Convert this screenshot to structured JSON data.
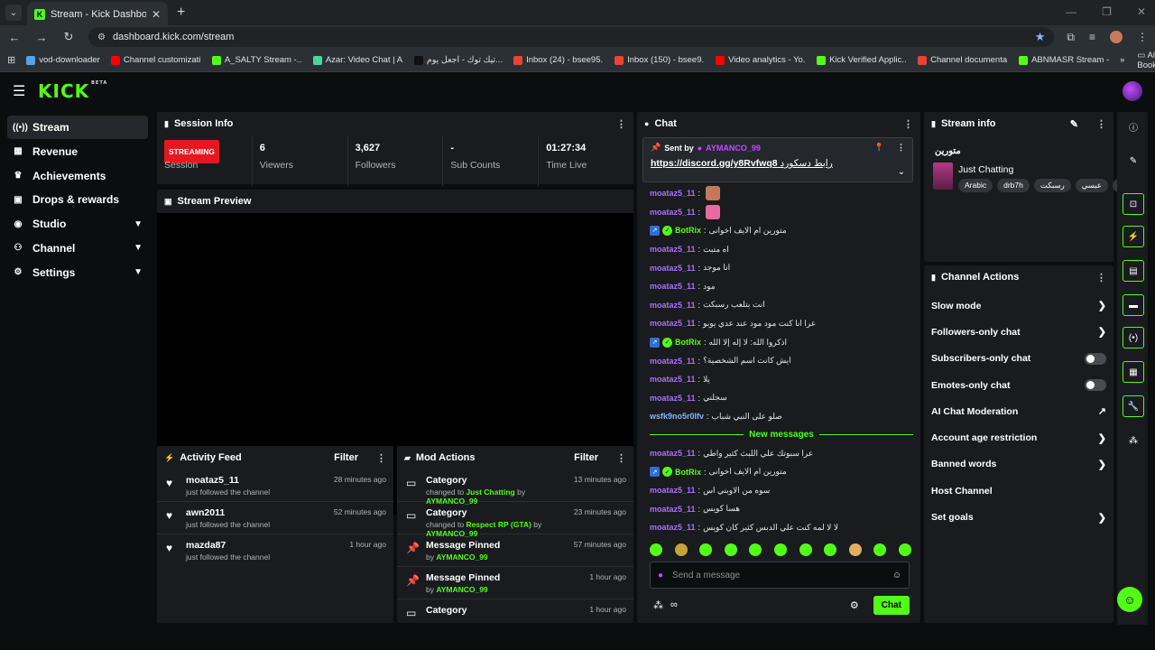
{
  "browser": {
    "tab_title": "Stream - Kick Dashboard",
    "url": "dashboard.kick.com/stream",
    "bookmarks": [
      {
        "label": "vod-downloader",
        "color": "#53a4e8"
      },
      {
        "label": "Channel customizati...",
        "color": "#ff0000"
      },
      {
        "label": "A_SALTY Stream -...",
        "color": "#53fc18"
      },
      {
        "label": "Azar: Video Chat | A...",
        "color": "#4ad6a0"
      },
      {
        "label": "تيك توك - اجعل يوم...",
        "color": "#111111"
      },
      {
        "label": "Inbox (24) - bsee95...",
        "color": "#ea4335"
      },
      {
        "label": "Inbox (150) - bsee9...",
        "color": "#ea4335"
      },
      {
        "label": "Video analytics - Yo...",
        "color": "#ff0000"
      },
      {
        "label": "Kick Verified Applic...",
        "color": "#53fc18"
      },
      {
        "label": "Channel documenta...",
        "color": "#ea4335"
      },
      {
        "label": "ABNMASR Stream -...",
        "color": "#53fc18"
      }
    ],
    "all_bookmarks": "All Bookmarks"
  },
  "app": {
    "logo": "KICK",
    "logo_badge": "BETA"
  },
  "sidebar": {
    "items": [
      {
        "label": "Stream",
        "icon": "broadcast-icon"
      },
      {
        "label": "Revenue",
        "icon": "revenue-icon"
      },
      {
        "label": "Achievements",
        "icon": "trophy-icon"
      },
      {
        "label": "Drops & rewards",
        "icon": "gift-icon"
      },
      {
        "label": "Studio",
        "icon": "studio-icon"
      },
      {
        "label": "Channel",
        "icon": "channel-icon"
      },
      {
        "label": "Settings",
        "icon": "gear-icon"
      }
    ]
  },
  "session": {
    "title": "Session Info",
    "status": "STREAMING",
    "status_label": "Session",
    "viewers": "6",
    "viewers_label": "Viewers",
    "followers": "3,627",
    "followers_label": "Followers",
    "subs": "-",
    "subs_label": "Sub Counts",
    "time": "01:27:34",
    "time_label": "Time Live"
  },
  "preview": {
    "title": "Stream Preview"
  },
  "activity": {
    "title": "Activity Feed",
    "filter": "Filter",
    "items": [
      {
        "name": "moataz5_11",
        "sub": "just followed the channel",
        "time": "28 minutes ago"
      },
      {
        "name": "awn2011",
        "sub": "just followed the channel",
        "time": "52 minutes ago"
      },
      {
        "name": "mazda87",
        "sub": "just followed the channel",
        "time": "1 hour ago"
      }
    ]
  },
  "mod": {
    "title": "Mod Actions",
    "filter": "Filter",
    "items": [
      {
        "title": "Category",
        "pre": "changed to ",
        "hl": "Just Chatting",
        "mid": " by ",
        "by": "AYMANCO_99",
        "time": "13 minutes ago",
        "icon": "category-icon"
      },
      {
        "title": "Category",
        "pre": "changed to ",
        "hl": "Respect RP (GTA)",
        "mid": " by ",
        "by": "AYMANCO_99",
        "time": "23 minutes ago",
        "icon": "category-icon"
      },
      {
        "title": "Message Pinned",
        "pre": "by ",
        "hl": "",
        "mid": "",
        "by": "AYMANCO_99",
        "time": "57 minutes ago",
        "icon": "pin-icon"
      },
      {
        "title": "Message Pinned",
        "pre": "by ",
        "hl": "",
        "mid": "",
        "by": "AYMANCO_99",
        "time": "1 hour ago",
        "icon": "pin-icon"
      },
      {
        "title": "Category",
        "pre": "",
        "hl": "",
        "mid": "",
        "by": "",
        "time": "1 hour ago",
        "icon": "category-icon"
      }
    ]
  },
  "chat": {
    "title": "Chat",
    "pinned_sent_by": "Sent by",
    "pinned_user": "AYMANCO_99",
    "pinned_link": "https://discord.gg/y8Rvfwq8",
    "pinned_text": "رابط دسكورد",
    "messages": [
      {
        "user": "moataz5_11",
        "color": "#a970ff",
        "text": "",
        "emote": "#c47a5a",
        "bot": false
      },
      {
        "user": "moataz5_11",
        "color": "#a970ff",
        "text": "",
        "emote": "#e96aa0",
        "bot": false
      },
      {
        "user": "BotRix",
        "color": "#53fc18",
        "text": "متورين ام الايف اخوانى",
        "emote": "",
        "bot": true
      },
      {
        "user": "moataz5_11",
        "color": "#a970ff",
        "text": "اه متبت",
        "emote": "",
        "bot": false
      },
      {
        "user": "moataz5_11",
        "color": "#a970ff",
        "text": "انا موجد",
        "emote": "",
        "bot": false
      },
      {
        "user": "moataz5_11",
        "color": "#a970ff",
        "text": "مود",
        "emote": "",
        "bot": false
      },
      {
        "user": "moataz5_11",
        "color": "#a970ff",
        "text": "انت بتلعب رسبكت",
        "emote": "",
        "bot": false
      },
      {
        "user": "moataz5_11",
        "color": "#a970ff",
        "text": "عرا انا كنت مود مود عند عدي يوبو",
        "emote": "",
        "bot": false
      },
      {
        "user": "BotRix",
        "color": "#53fc18",
        "text": "اذكروا الله: لا إله إلا الله",
        "emote": "",
        "bot": true
      },
      {
        "user": "moataz5_11",
        "color": "#a970ff",
        "text": "ايش كانت اسم الشخصية؟",
        "emote": "",
        "bot": false
      },
      {
        "user": "moataz5_11",
        "color": "#a970ff",
        "text": "يلا",
        "emote": "",
        "bot": false
      },
      {
        "user": "moataz5_11",
        "color": "#a970ff",
        "text": "سجلني",
        "emote": "",
        "bot": false
      },
      {
        "user": "wsfk9no5r0lfv",
        "color": "#8ab4f8",
        "text": "صلو على النبي شباب",
        "emote": "",
        "bot": false
      }
    ],
    "new_messages": "New messages",
    "new_msgs": [
      {
        "user": "moataz5_11",
        "color": "#a970ff",
        "text": "عرا سبوتك علي اللبث كثير واطي",
        "emote": "",
        "bot": false
      },
      {
        "user": "BotRix",
        "color": "#53fc18",
        "text": "متورين ام الايف اخوانى",
        "emote": "",
        "bot": true
      },
      {
        "user": "moataz5_11",
        "color": "#a970ff",
        "text": "سوه من الاوبني اس",
        "emote": "",
        "bot": false
      },
      {
        "user": "moataz5_11",
        "color": "#a970ff",
        "text": "هسا كويس",
        "emote": "",
        "bot": false
      },
      {
        "user": "moataz5_11",
        "color": "#a970ff",
        "text": "لا لا لمه كنت علي الدبس كثير كان كويس",
        "emote": "",
        "bot": false
      }
    ],
    "input_placeholder": "Send a message",
    "send_label": "Chat",
    "emote_colors": [
      "#53fc18",
      "#c8a23a",
      "#53fc18",
      "#53fc18",
      "#53fc18",
      "#53fc18",
      "#53fc18",
      "#53fc18",
      "#e0b060",
      "#53fc18",
      "#53fc18"
    ]
  },
  "stream_info": {
    "title": "Stream info",
    "stream_title": "متورين",
    "category": "Just Chatting",
    "tags": [
      "Arabic",
      "drb7h",
      "رسبكت",
      "عبسي",
      "ي"
    ]
  },
  "channel_actions": {
    "title": "Channel Actions",
    "items": [
      {
        "label": "Slow mode",
        "kind": "chevron"
      },
      {
        "label": "Followers-only chat",
        "kind": "chevron"
      },
      {
        "label": "Subscribers-only chat",
        "kind": "toggle"
      },
      {
        "label": "Emotes-only chat",
        "kind": "toggle"
      },
      {
        "label": "AI Chat Moderation",
        "kind": "external"
      },
      {
        "label": "Account age restriction",
        "kind": "chevron"
      },
      {
        "label": "Banned words",
        "kind": "chevron"
      },
      {
        "label": "Host Channel",
        "kind": "none"
      },
      {
        "label": "Set goals",
        "kind": "chevron"
      }
    ]
  },
  "icons": {
    "rail": [
      "info-icon",
      "edit-icon",
      "scan-icon",
      "bolt-icon",
      "clipboard-icon",
      "chat-bubble-icon",
      "broadcast-icon",
      "layout-icon",
      "wrench-icon",
      "share-icon"
    ]
  }
}
